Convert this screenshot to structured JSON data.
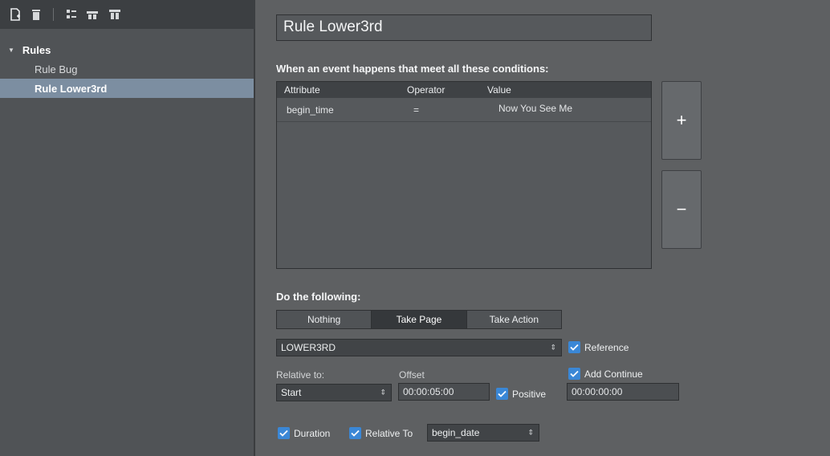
{
  "toolbar": {
    "icons": [
      "new-rule-icon",
      "delete-icon",
      "checklist-icon",
      "expand-icon",
      "collapse-icon"
    ]
  },
  "tree": {
    "root_label": "Rules",
    "items": [
      {
        "label": "Rule Bug"
      },
      {
        "label": "Rule Lower3rd"
      }
    ]
  },
  "rule": {
    "name": "Rule Lower3rd"
  },
  "conditions": {
    "heading": "When an event happens that meet all these conditions:",
    "columns": [
      "Attribute",
      "Operator",
      "Value"
    ],
    "rows": [
      {
        "attribute": "begin_time",
        "operator": "=",
        "value": "Now You See Me"
      }
    ],
    "add_label": "+",
    "remove_label": "−"
  },
  "action": {
    "heading": "Do the following:",
    "tabs": [
      "Nothing",
      "Take Page",
      "Take Action"
    ],
    "active_tab": "Take Page",
    "page_value": "LOWER3RD",
    "reference_label": "Reference",
    "relative_to_label": "Relative to:",
    "relative_to_value": "Start",
    "offset_label": "Offset",
    "offset_value": "00:00:05:00",
    "positive_label": "Positive",
    "add_continue_label": "Add Continue",
    "continue_value": "00:00:00:00",
    "duration_label": "Duration",
    "relative_to_check_label": "Relative To",
    "relative_to_field_value": "begin_date"
  },
  "colors": {
    "accent": "#3a87d6",
    "selection": "#7c8ea1"
  }
}
